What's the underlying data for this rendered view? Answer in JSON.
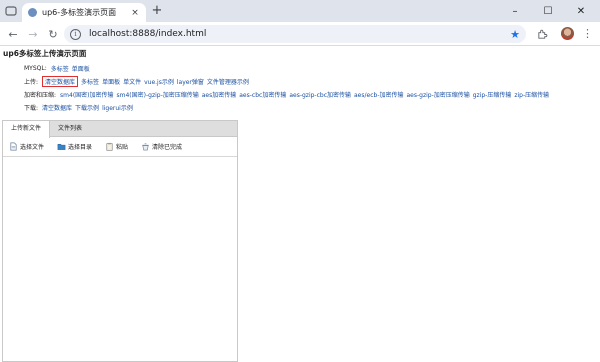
{
  "browser": {
    "tab_title": "up6-多标签演示页面",
    "tab_close": "×",
    "new_tab": "+",
    "window_controls": {
      "minimize": "–",
      "maximize": "☐",
      "close": "✕"
    },
    "nav": {
      "back": "←",
      "forward": "→",
      "reload": "↻"
    },
    "url": "localhost:8888/index.html",
    "bookmark_icon": "★",
    "menu": "⋮"
  },
  "page": {
    "title": "up6多标签上传演示页面",
    "mysql_row": {
      "label": "MYSQL:",
      "links": [
        "多标签",
        "单面板"
      ]
    },
    "upload_row": {
      "label": "上传:",
      "highlighted": "清空数据库",
      "links": [
        "多标签",
        "单面板",
        "单文件",
        "vue.js示例",
        "layer弹窗",
        "文件管理器示例"
      ]
    },
    "encrypt_row": {
      "label": "加密和压缩:",
      "links": [
        "sm4(国密)加密传输",
        "sm4(国密)-gzip-加密压缩传输",
        "aes加密传输",
        "aes-cbc加密传输",
        "aes-gzip-cbc加密传输",
        "aes/ecb-加密传输",
        "aes-gzip-加密压缩传输",
        "gzip-压缩传输",
        "zip-压缩传输"
      ]
    },
    "download_row": {
      "label": "下载:",
      "links": [
        "清空数据库",
        "下载示例",
        "ligerui示例"
      ]
    }
  },
  "uploader": {
    "tabs": [
      "上传新文件",
      "文件列表"
    ],
    "toolbar": {
      "select_file": "选择文件",
      "select_folder": "选择目录",
      "paste": "粘贴",
      "clear_done": "清除已完成"
    }
  },
  "colors": {
    "link": "#1a4fa0",
    "highlight_border": "#e03030",
    "tabstrip_bg": "#dfe3eb",
    "omnibox_bg": "#eef1f8"
  }
}
